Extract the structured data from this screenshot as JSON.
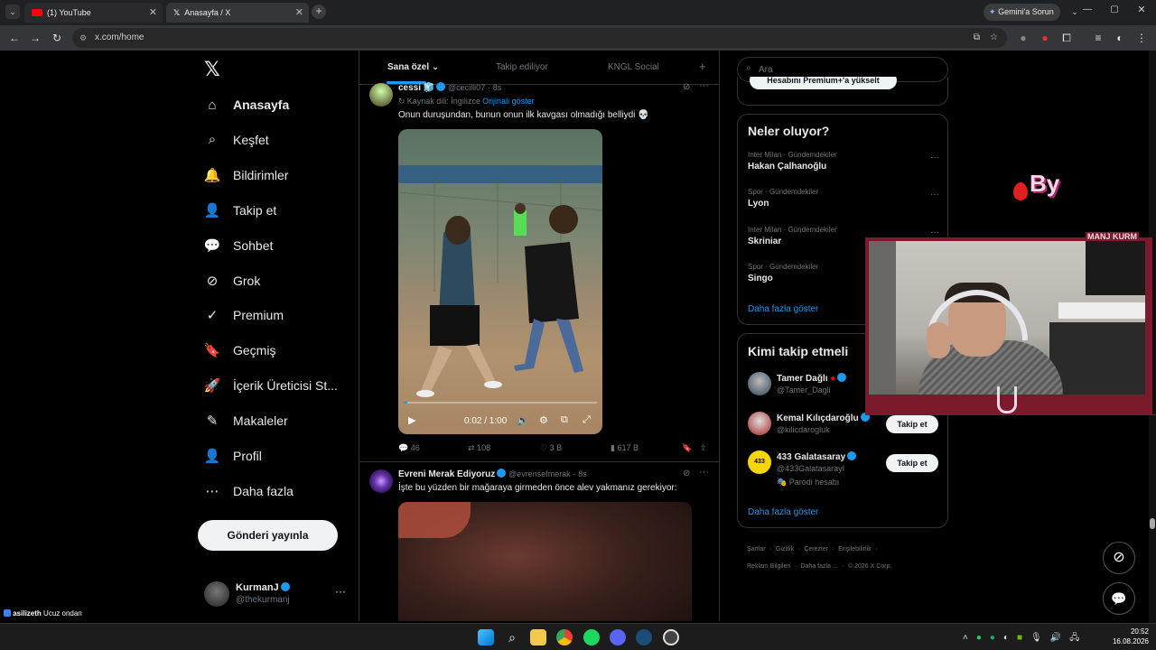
{
  "browser": {
    "tabs": [
      {
        "label": "(1) YouTube"
      },
      {
        "label": "Anasayfa / X"
      }
    ],
    "url": "x.com/home",
    "gemini": "Gemini'a Sorun"
  },
  "sidebar": {
    "items": [
      {
        "label": "Anasayfa",
        "icon": "home-icon"
      },
      {
        "label": "Keşfet",
        "icon": "search-icon"
      },
      {
        "label": "Bildirimler",
        "icon": "bell-icon"
      },
      {
        "label": "Takip et",
        "icon": "add-person-icon"
      },
      {
        "label": "Sohbet",
        "icon": "chat-icon"
      },
      {
        "label": "Grok",
        "icon": "grok-icon"
      },
      {
        "label": "Premium",
        "icon": "premium-icon"
      },
      {
        "label": "Geçmiş",
        "icon": "bookmark-icon"
      },
      {
        "label": "İçerik Üreticisi St...",
        "icon": "rocket-icon"
      },
      {
        "label": "Makaleler",
        "icon": "article-icon"
      },
      {
        "label": "Profil",
        "icon": "person-icon"
      },
      {
        "label": "Daha fazla",
        "icon": "more-icon"
      }
    ],
    "post_button": "Gönderi yayınla",
    "account": {
      "name": "KurmanJ",
      "handle": "@thekurmanj"
    }
  },
  "feed": {
    "tabs": [
      "Sana özel",
      "Takip ediliyor",
      "KNGL Social"
    ],
    "post1": {
      "name": "cessi",
      "handle": "@cecilli07",
      "time": "8s",
      "source_lang": "Kaynak dili: İngilizce",
      "show_original": "Orijinali göster",
      "text": "Onun duruşundan, bunun onun ilk kavgası olmadığı belliydi 💀",
      "video_time": "0:02 / 1:00",
      "replies": "46",
      "reposts": "108",
      "likes": "3 B",
      "views": "617 B"
    },
    "post2": {
      "name": "Evreni Merak Ediyoruz",
      "handle": "@evrenseImerak",
      "time": "8s",
      "text": "İşte bu yüzden bir mağaraya girmeden önce alev yakmanız gerekiyor:"
    }
  },
  "right": {
    "search_placeholder": "Ara",
    "premium_button": "Hesabını Premium+'a yükselt",
    "trends_title": "Neler oluyor?",
    "trends": [
      {
        "meta": "Inter Milan · Gündemdekiler",
        "name": "Hakan Çalhanoğlu"
      },
      {
        "meta": "Spor · Gündemdekiler",
        "name": "Lyon"
      },
      {
        "meta": "Inter Milan · Gündemdekiler",
        "name": "Skriniar"
      },
      {
        "meta": "Spor · Gündemdekiler",
        "name": "Singo"
      }
    ],
    "show_more": "Daha fazla göster",
    "follow_title": "Kimi takip etmeli",
    "follow": [
      {
        "name": "Tamer Dağlı",
        "handle": "@Tamer_Dagli",
        "button": ""
      },
      {
        "name": "Kemal Kılıçdaroğlu",
        "handle": "@kilicdarogluk",
        "button": "Takip et"
      },
      {
        "name": "433 Galatasaray",
        "handle": "@433GalatasarayI",
        "note": "Parodi hesabı",
        "button": "Takip et"
      }
    ],
    "footer": [
      "Şartlar",
      "Gizlilik",
      "Çerezler",
      "Erişilebilirlik",
      "Reklam Bilgileri",
      "Daha fazla ...",
      "© 2026 X Corp."
    ]
  },
  "overlay": {
    "by_text": "By",
    "ticker": "MANJ  KURM",
    "chat": {
      "user": "asilizeth",
      "msg": "Ucuz ondan"
    }
  },
  "taskbar": {
    "time": "20:52",
    "date": "16.08.2026"
  },
  "colors": {
    "accent": "#1d9bf0",
    "bg": "#000000",
    "border": "#2f3336",
    "overlay_frame": "#7a1a2a"
  }
}
